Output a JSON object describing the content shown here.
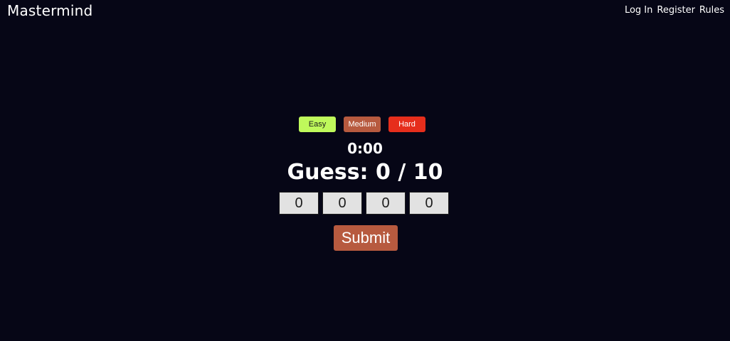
{
  "header": {
    "title": "Mastermind",
    "nav": {
      "login": "Log In",
      "register": "Register",
      "rules": "Rules"
    }
  },
  "game": {
    "difficulty": {
      "easy": "Easy",
      "medium": "Medium",
      "hard": "Hard"
    },
    "timer": "0:00",
    "guess_label": "Guess: 0 / 10",
    "slots": [
      "0",
      "0",
      "0",
      "0"
    ],
    "submit_label": "Submit"
  },
  "colors": {
    "background": "#060616",
    "easy": "#bff95b",
    "medium": "#b75a3f",
    "hard": "#e62e1c",
    "submit": "#b75a3f",
    "slot": "#e2e2e2"
  }
}
